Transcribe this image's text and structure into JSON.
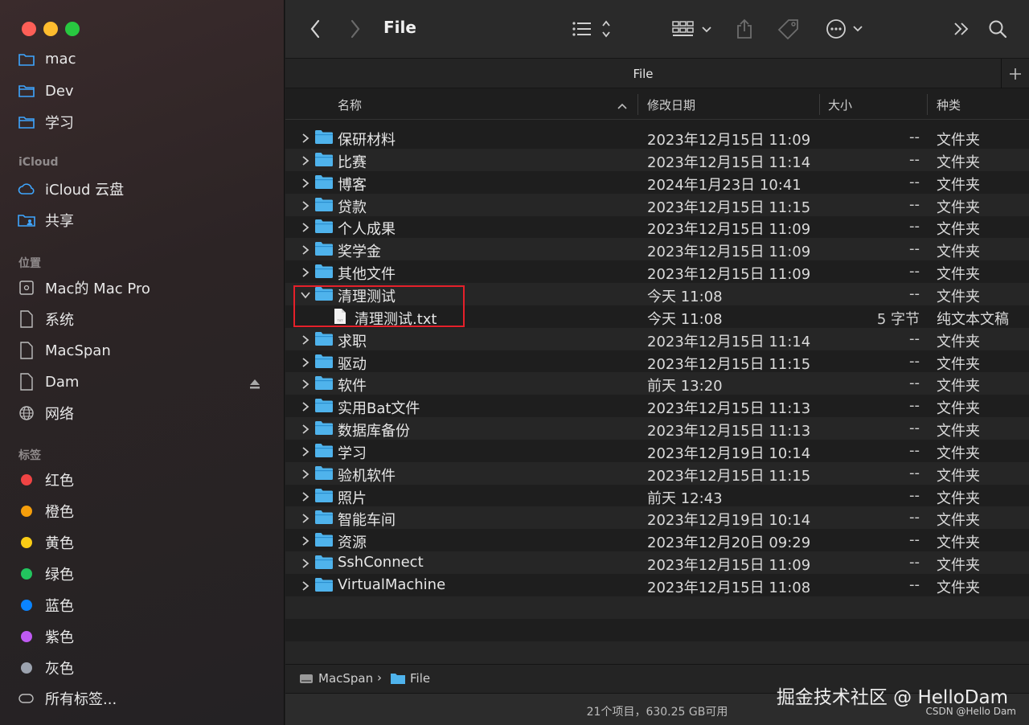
{
  "window": {
    "title": "File",
    "tab_title": "File"
  },
  "colors": {
    "folder": "#4fb3ec",
    "highlight_box": "#e5202a"
  },
  "sidebar": {
    "favorites_partial": {
      "label": "mac",
      "icon": "folder-icon"
    },
    "favorites": [
      {
        "label": "Dev",
        "icon": "folder-icon"
      },
      {
        "label": "学习",
        "icon": "folder-icon"
      }
    ],
    "icloud_heading": "iCloud",
    "icloud": [
      {
        "label": "iCloud 云盘",
        "icon": "cloud-icon"
      },
      {
        "label": "共享",
        "icon": "shared-folder-icon"
      }
    ],
    "locations_heading": "位置",
    "locations": [
      {
        "label": "Mac的 Mac Pro",
        "icon": "computer-icon"
      },
      {
        "label": "系统",
        "icon": "disk-icon"
      },
      {
        "label": "MacSpan",
        "icon": "disk-icon"
      },
      {
        "label": "Dam",
        "icon": "disk-icon"
      },
      {
        "label": "网络",
        "icon": "network-icon"
      }
    ],
    "tags_heading": "标签",
    "tags": [
      {
        "label": "红色",
        "color": "#ef4444"
      },
      {
        "label": "橙色",
        "color": "#f59e0b"
      },
      {
        "label": "黄色",
        "color": "#facc15"
      },
      {
        "label": "绿色",
        "color": "#22c55e"
      },
      {
        "label": "蓝色",
        "color": "#0a84ff"
      },
      {
        "label": "紫色",
        "color": "#bf5af2"
      },
      {
        "label": "灰色",
        "color": "#9ca3af"
      }
    ],
    "all_tags": "所有标签..."
  },
  "columns": {
    "name": "名称",
    "date": "修改日期",
    "size": "大小",
    "kind": "种类"
  },
  "rows": [
    {
      "name": "保研材料",
      "date": "2023年12月15日 11:09",
      "size": "--",
      "kind": "文件夹"
    },
    {
      "name": "比赛",
      "date": "2023年12月15日 11:14",
      "size": "--",
      "kind": "文件夹"
    },
    {
      "name": "博客",
      "date": "2024年1月23日 10:41",
      "size": "--",
      "kind": "文件夹"
    },
    {
      "name": "贷款",
      "date": "2023年12月15日 11:15",
      "size": "--",
      "kind": "文件夹"
    },
    {
      "name": "个人成果",
      "date": "2023年12月15日 11:09",
      "size": "--",
      "kind": "文件夹"
    },
    {
      "name": "奖学金",
      "date": "2023年12月15日 11:09",
      "size": "--",
      "kind": "文件夹"
    },
    {
      "name": "其他文件",
      "date": "2023年12月15日 11:09",
      "size": "--",
      "kind": "文件夹"
    },
    {
      "name": "清理测试",
      "date": "今天 11:08",
      "size": "--",
      "kind": "文件夹",
      "expanded": true
    },
    {
      "name": "清理测试.txt",
      "date": "今天 11:08",
      "size": "5 字节",
      "kind": "纯文本文稿",
      "file": true,
      "file_badge": "TXT"
    },
    {
      "name": "求职",
      "date": "2023年12月15日 11:14",
      "size": "--",
      "kind": "文件夹"
    },
    {
      "name": "驱动",
      "date": "2023年12月15日 11:15",
      "size": "--",
      "kind": "文件夹"
    },
    {
      "name": "软件",
      "date": "前天 13:20",
      "size": "--",
      "kind": "文件夹"
    },
    {
      "name": "实用Bat文件",
      "date": "2023年12月15日 11:13",
      "size": "--",
      "kind": "文件夹"
    },
    {
      "name": "数据库备份",
      "date": "2023年12月15日 11:13",
      "size": "--",
      "kind": "文件夹"
    },
    {
      "name": "学习",
      "date": "2023年12月19日 10:14",
      "size": "--",
      "kind": "文件夹"
    },
    {
      "name": "验机软件",
      "date": "2023年12月15日 11:15",
      "size": "--",
      "kind": "文件夹"
    },
    {
      "name": "照片",
      "date": "前天 12:43",
      "size": "--",
      "kind": "文件夹"
    },
    {
      "name": "智能车间",
      "date": "2023年12月19日 10:14",
      "size": "--",
      "kind": "文件夹"
    },
    {
      "name": "资源",
      "date": "2023年12月20日 09:29",
      "size": "--",
      "kind": "文件夹"
    },
    {
      "name": "SshConnect",
      "date": "2023年12月15日 11:09",
      "size": "--",
      "kind": "文件夹"
    },
    {
      "name": "VirtualMachine",
      "date": "2023年12月15日 11:08",
      "size": "--",
      "kind": "文件夹"
    }
  ],
  "pathbar": {
    "volume": "MacSpan",
    "separator": "›",
    "folder": "File"
  },
  "status": "21个项目，630.25 GB可用",
  "watermark": {
    "main": "掘金技术社区 @ HelloDam",
    "sub": "CSDN @Hello Dam"
  }
}
